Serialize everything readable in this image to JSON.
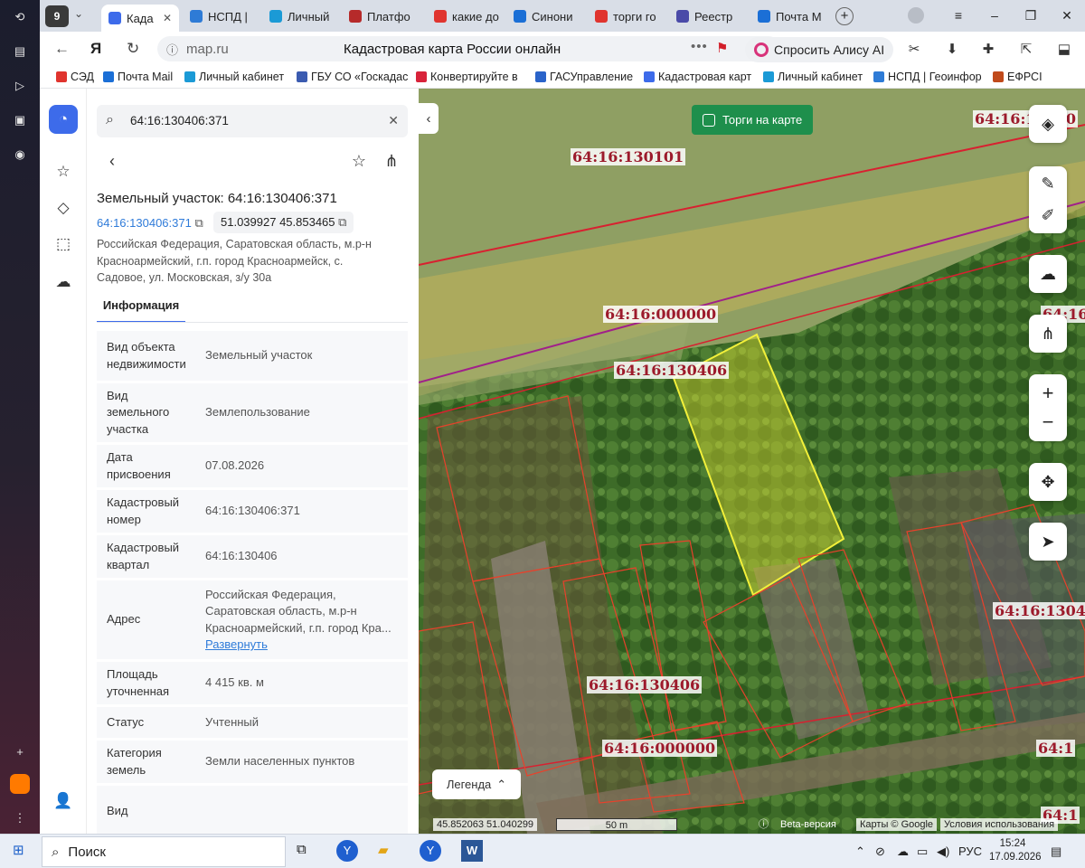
{
  "browser": {
    "tab_count": "9",
    "tabs": [
      {
        "label": "Када",
        "active": true,
        "color": "#3d6bea"
      },
      {
        "label": "НСПД |",
        "color": "#2e7bd6"
      },
      {
        "label": "Личный",
        "color": "#1b9ad6"
      },
      {
        "label": "Платфо",
        "color": "#b62a2a"
      },
      {
        "label": "какие до",
        "color": "#e0342e"
      },
      {
        "label": "Синони",
        "color": "#1b6fd6"
      },
      {
        "label": "торги го",
        "color": "#e0342e"
      },
      {
        "label": "Реестр",
        "color": "#4a4aa8"
      },
      {
        "label": "Почта М",
        "color": "#1b6fd6"
      }
    ],
    "url_host": "map.ru",
    "page_title": "Кадастровая карта России онлайн",
    "alice_button": "Спросить Алису AI",
    "bookmarks": [
      {
        "label": "СЭД",
        "color": "#e0342e"
      },
      {
        "label": "Почта Mail",
        "color": "#1b6fd6"
      },
      {
        "label": "Личный кабинет",
        "color": "#1b9ad6"
      },
      {
        "label": "ГБУ СО «Госкадас",
        "color": "#3b5bb0"
      },
      {
        "label": "Конвертируйте в",
        "color": "#d8233a"
      },
      {
        "label": "ГАСУправление",
        "color": "#2a63c9"
      },
      {
        "label": "Кадастровая карт",
        "color": "#3d6bea"
      },
      {
        "label": "Личный кабинет",
        "color": "#1b9ad6"
      },
      {
        "label": "НСПД | Геоинфор",
        "color": "#2e7bd6"
      },
      {
        "label": "ЕФРСІ",
        "color": "#c04a1b"
      }
    ]
  },
  "search": {
    "query": "64:16:130406:371"
  },
  "object": {
    "title": "Земельный участок: 64:16:130406:371",
    "cad_link": "64:16:130406:371",
    "coords": "51.039927 45.853465",
    "address_lines": [
      "Российская Федерация, Саратовская область, м.р-н",
      "Красноармейский, г.п. город Красноармейск, с.",
      "Садовое, ул. Московская, з/у 30а"
    ],
    "tab_label": "Информация"
  },
  "info_rows": [
    {
      "key": [
        "Вид объекта",
        "недвижимости"
      ],
      "value": [
        "Земельный участок"
      ]
    },
    {
      "key": [
        "Вид",
        "земельного",
        "участка"
      ],
      "value": [
        "Землепользование"
      ]
    },
    {
      "key": [
        "Дата",
        "присвоения"
      ],
      "value": [
        "07.08.2026"
      ]
    },
    {
      "key": [
        "Кадастровый",
        "номер"
      ],
      "value": [
        "64:16:130406:371"
      ]
    },
    {
      "key": [
        "Кадастровый",
        "квартал"
      ],
      "value": [
        "64:16:130406"
      ]
    },
    {
      "key": [
        "Адрес"
      ],
      "value": [
        "Российская Федерация,",
        "Саратовская область, м.р-н",
        "Красноармейский, г.п. город Кра..."
      ],
      "link": "Развернуть"
    },
    {
      "key": [
        "Площадь",
        "уточненная"
      ],
      "value": [
        "4 415 кв. м"
      ]
    },
    {
      "key": [
        "Статус"
      ],
      "value": [
        "Учтенный"
      ]
    },
    {
      "key": [
        "Категория",
        "земель"
      ],
      "value": [
        "Земли населенных пунктов"
      ]
    },
    {
      "key": [
        "Вид"
      ],
      "value": [
        ""
      ]
    }
  ],
  "map": {
    "torgi_label": "Торги на карте",
    "legend_label": "Легенда",
    "cad_labels": {
      "a": "64:16:130101",
      "b": "64:16:000000",
      "c": "64:16:130406",
      "d": "64:16:130406",
      "e": "64:16:000000",
      "f": "64:16:13010",
      "g": "64:16:13040",
      "h": "64:16:",
      "i": "64:1",
      "j": "64:1"
    },
    "footer": {
      "coords": "45.852063  51.040299",
      "scale": "50 m",
      "beta": "Beta-версия",
      "copyright": "Карты © Google",
      "terms": "Условия использования"
    }
  },
  "taskbar": {
    "search": "Поиск",
    "lang": "РУС",
    "time": "15:24",
    "date": "17.09.2026"
  }
}
